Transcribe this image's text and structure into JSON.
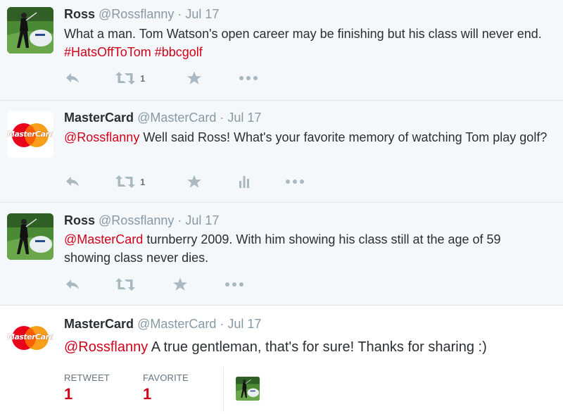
{
  "tweets": [
    {
      "name": "Ross",
      "handle": "@Rossflanny",
      "sep": "·",
      "date": "Jul 17",
      "text_parts": [
        "What a man. Tom Watson's open career may be finishing but his class will never end. ",
        "#HatsOffToTom",
        " ",
        "#bbcgolf"
      ],
      "retweet_count": "1"
    },
    {
      "name": "MasterCard",
      "handle": "@MasterCard",
      "sep": "·",
      "date": "Jul 17",
      "text_parts": [
        "@Rossflanny",
        " Well said Ross! What's your favorite memory of watching Tom play golf?"
      ],
      "retweet_count": "1"
    },
    {
      "name": "Ross",
      "handle": "@Rossflanny",
      "sep": "·",
      "date": "Jul 17",
      "text_parts": [
        "@MasterCard",
        " turnberry 2009. With him showing his class still at the age of 59 showing class never dies."
      ]
    },
    {
      "name": "MasterCard",
      "handle": "@MasterCard",
      "sep": "·",
      "date": "Jul 17",
      "text_parts": [
        "@Rossflanny",
        " A true gentleman, that's for sure! Thanks for sharing :)"
      ],
      "stats": {
        "retweet_label": "RETWEET",
        "retweet_value": "1",
        "favorite_label": "FAVORITE",
        "favorite_value": "1"
      }
    }
  ],
  "logo_text": "MasterCard",
  "colors": {
    "highlight": "#d0021b",
    "muted": "#8899a6",
    "icon": "#aab8c2",
    "name": "#292f33",
    "mc_red": "#eb001b",
    "mc_orange": "#f79e1b"
  },
  "icons": [
    "reply-icon",
    "retweet-icon",
    "favorite-icon",
    "analytics-icon",
    "more-icon"
  ]
}
